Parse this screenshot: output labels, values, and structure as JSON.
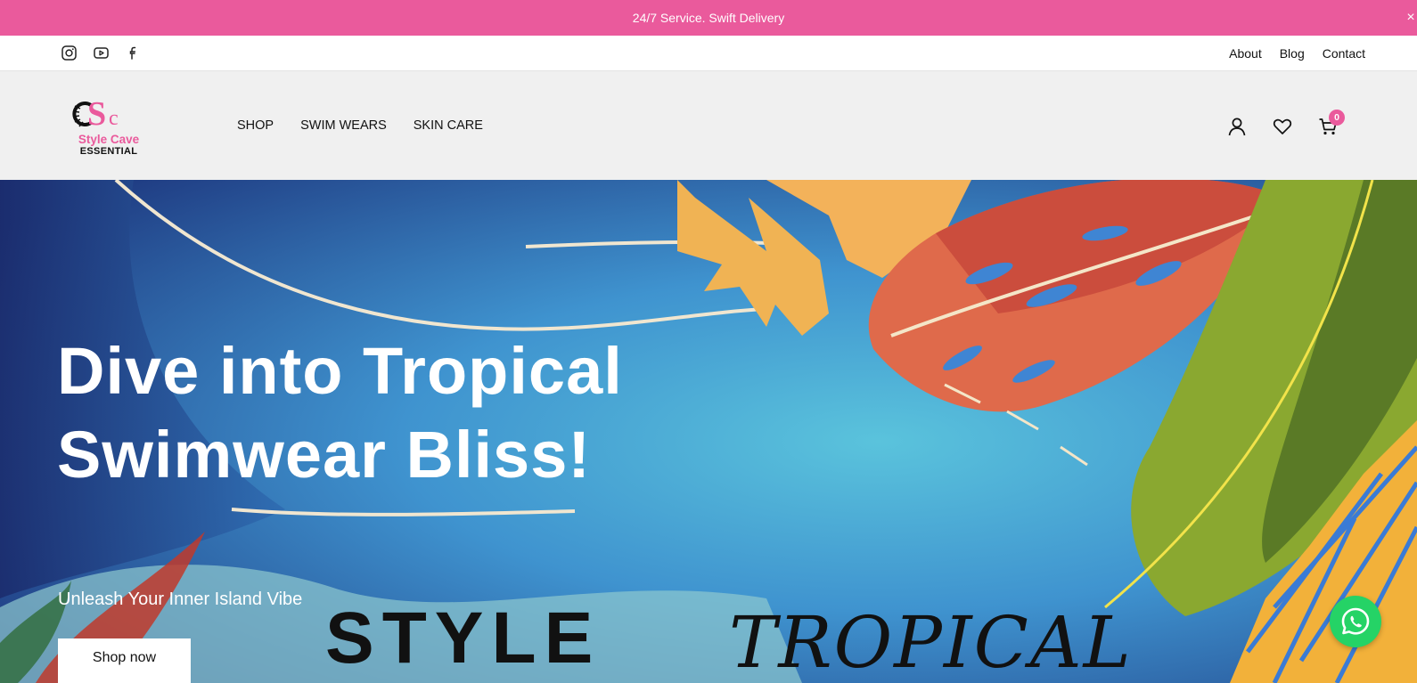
{
  "announcement": {
    "text": "24/7 Service. Swift Delivery",
    "close_label": "×"
  },
  "topbar": {
    "social_icons": [
      "instagram-icon",
      "youtube-icon",
      "facebook-icon"
    ],
    "links": [
      "About",
      "Blog",
      "Contact"
    ]
  },
  "header": {
    "logo": {
      "line1": "Style Cave",
      "line2": "ESSENTIAL",
      "monogram": "SC"
    },
    "nav": [
      "SHOP",
      "SWIM WEARS",
      "SKIN CARE"
    ],
    "icons": [
      "user-icon",
      "heart-icon",
      "cart-icon"
    ],
    "cart_count": "0"
  },
  "hero": {
    "title_line1": "Dive into Tropical",
    "title_line2": "Swimwear Bliss!",
    "subtitle": "Unleash Your Inner Island Vibe",
    "button_label": "Shop now",
    "art_text_left": "STYLE",
    "art_text_right": "TROPICAL"
  },
  "whatsapp": {
    "icon": "whatsapp-icon"
  },
  "colors": {
    "brand_pink": "#ea5a9c",
    "header_bg": "#f0f0f0",
    "whatsapp_green": "#25d366"
  }
}
